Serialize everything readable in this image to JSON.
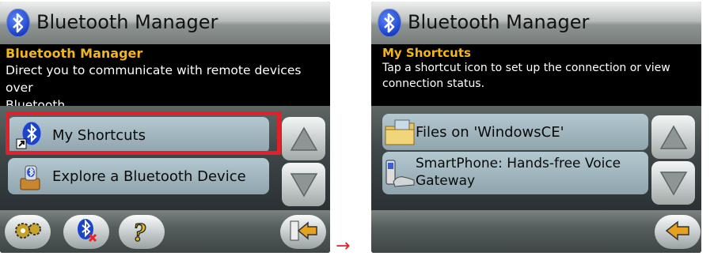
{
  "left": {
    "title": "Bluetooth Manager",
    "desc_title": "Bluetooth Manager",
    "desc_line1": "Direct you to communicate with remote devices over",
    "desc_line2": "Bluetooth.",
    "items": [
      {
        "label": "My Shortcuts",
        "icon": "bluetooth-shortcut-icon"
      },
      {
        "label": "Explore a Bluetooth Device",
        "icon": "explore-device-icon"
      }
    ],
    "toolbar": [
      "settings-gear-icon",
      "bluetooth-off-icon",
      "help-icon",
      "back-arrow-icon"
    ],
    "highlight_color": "#e0202a"
  },
  "right": {
    "title": "Bluetooth Manager",
    "desc_title": "My Shortcuts",
    "desc_line1": "Tap a shortcut icon to set up the connection or view",
    "desc_line2": "connection status.",
    "items": [
      {
        "label": "Files on 'WindowsCE'",
        "icon": "folder-icon"
      },
      {
        "label_line1": "SmartPhone: Hands-free Voice",
        "label_line2": "Gateway",
        "icon": "smartphone-icon"
      }
    ],
    "toolbar": [
      "back-arrow-icon"
    ]
  },
  "arrow": "→",
  "colors": {
    "accent_title": "#f2b51a",
    "highlight": "#e0202a",
    "arrow": "#e0202a"
  }
}
